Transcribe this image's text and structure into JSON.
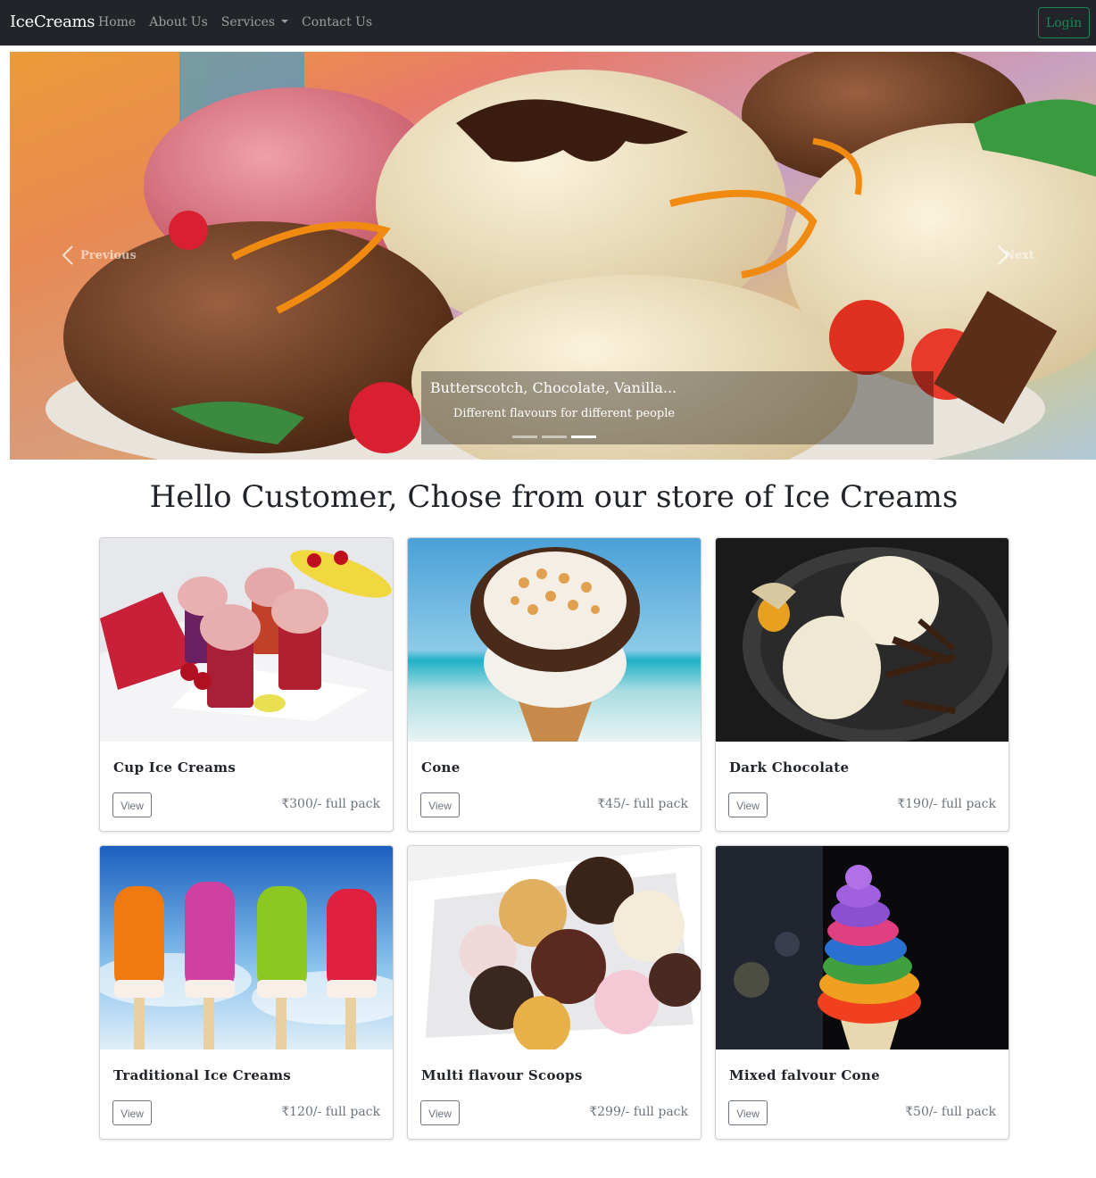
{
  "navbar": {
    "brand": "IceCreams",
    "links": [
      "Home",
      "About Us",
      "Services",
      "Contact Us"
    ],
    "login_label": "Login"
  },
  "carousel": {
    "prev_label": "Previous",
    "next_label": "Next",
    "caption_title": "Butterscotch, Chocolate, Vanilla...",
    "caption_text": "Different flavours for different people",
    "active_slide": 3
  },
  "main": {
    "heading": "Hello Customer, Chose from our store of Ice Creams"
  },
  "products": [
    {
      "title": "Cup Ice Creams",
      "view_label": "View",
      "price": "₹300/- full pack"
    },
    {
      "title": "Cone",
      "view_label": "View",
      "price": "₹45/- full pack"
    },
    {
      "title": "Dark Chocolate",
      "view_label": "View",
      "price": "₹190/- full pack"
    },
    {
      "title": "Traditional Ice Creams",
      "view_label": "View",
      "price": "₹120/- full pack"
    },
    {
      "title": "Multi flavour Scoops",
      "view_label": "View",
      "price": "₹299/- full pack"
    },
    {
      "title": "Mixed falvour Cone",
      "view_label": "View",
      "price": "₹50/- full pack"
    }
  ],
  "colors": {
    "navbar_bg": "#212529",
    "login_accent": "#198754",
    "muted": "#6c757d"
  }
}
